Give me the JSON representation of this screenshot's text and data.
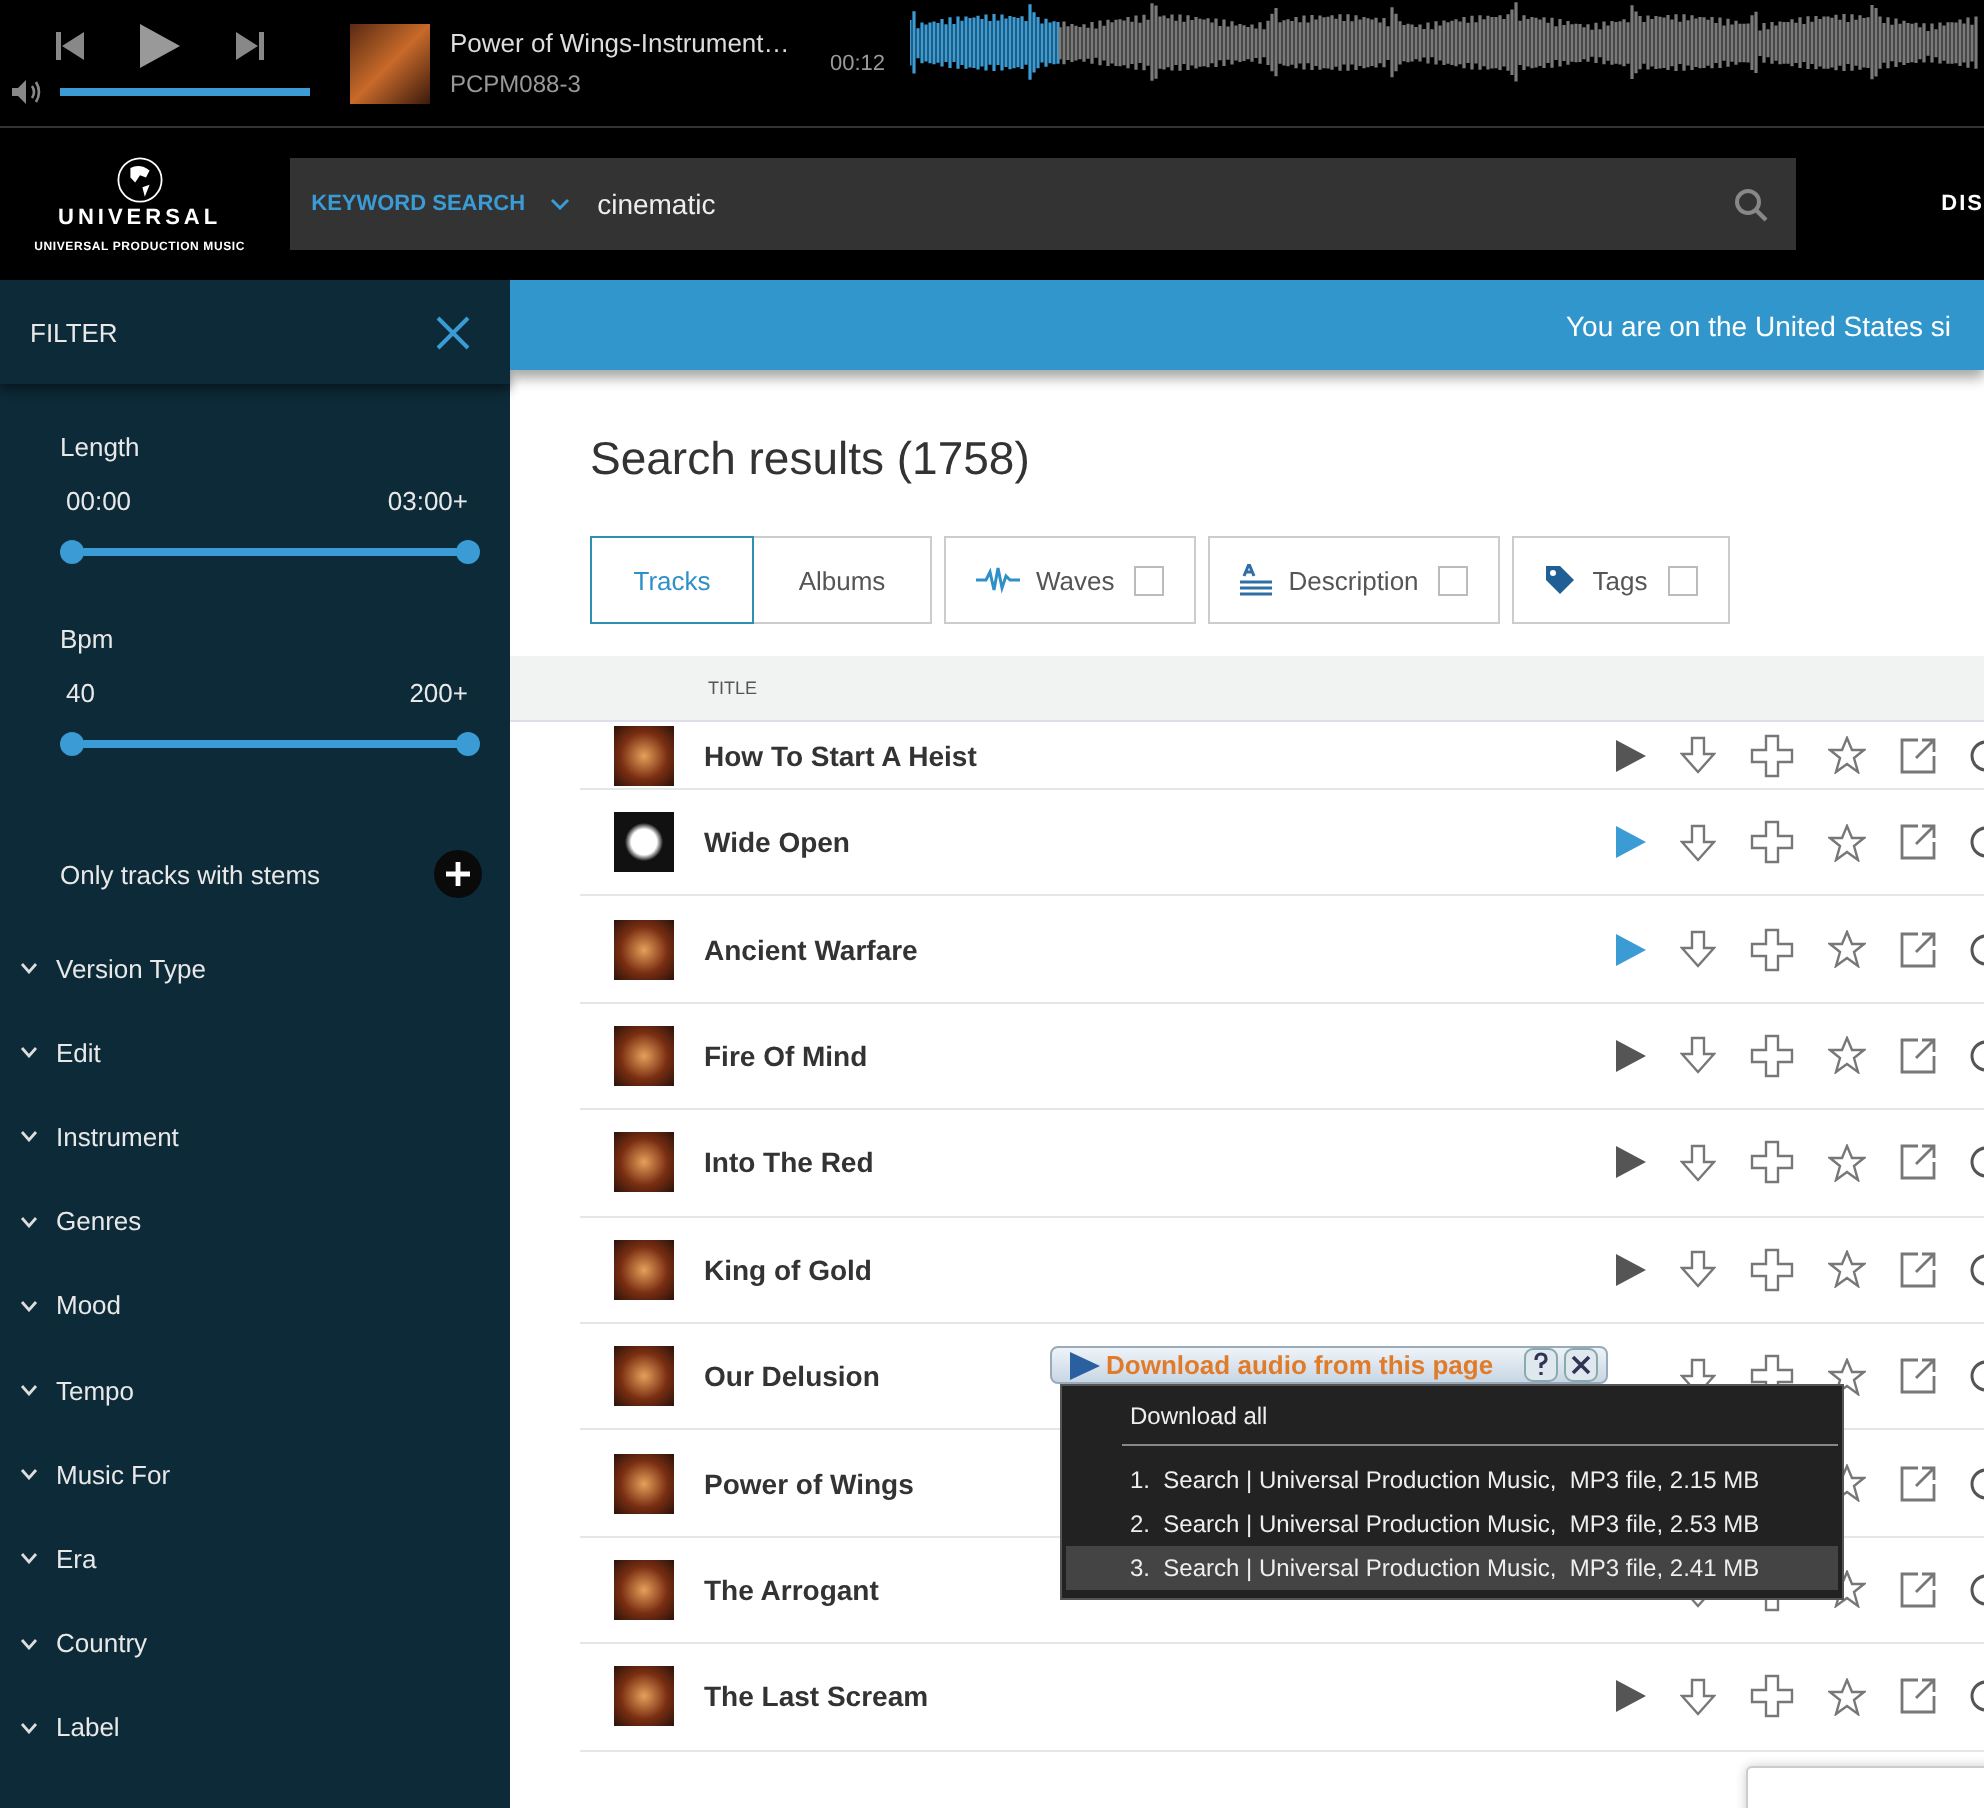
{
  "player": {
    "title": "Power of Wings-Instrument…",
    "code": "PCPM088-3",
    "time": "00:12",
    "volume": {
      "level": 1
    },
    "progress": {
      "level": 0.14
    }
  },
  "header": {
    "logo_name": "UNIVERSAL",
    "logo_tagline": "UNIVERSAL PRODUCTION MUSIC",
    "search": {
      "mode": "KEYWORD SEARCH",
      "value": "cinematic"
    },
    "nav_item": "DIS"
  },
  "banner": "You are on the United States si",
  "filter": {
    "title": "FILTER",
    "sliders": [
      {
        "label": "Length",
        "min": "00:00",
        "max": "03:00+",
        "level": 1
      },
      {
        "label": "Bpm",
        "min": "40",
        "max": "200+",
        "level": 1
      }
    ],
    "stems_label": "Only tracks with stems",
    "sections": [
      {
        "label": "Version Type",
        "expanded": false
      },
      {
        "label": "Edit",
        "expanded": false
      },
      {
        "label": "Instrument",
        "expanded": false
      },
      {
        "label": "Genres",
        "expanded": false
      },
      {
        "label": "Mood",
        "expanded": false
      },
      {
        "label": "Tempo",
        "expanded": false
      },
      {
        "label": "Music For",
        "expanded": false
      },
      {
        "label": "Era",
        "expanded": false
      },
      {
        "label": "Country",
        "expanded": false
      },
      {
        "label": "Label",
        "expanded": false
      }
    ]
  },
  "results": {
    "title": "Search results (1758)",
    "tabs": [
      {
        "label": "Tracks",
        "selected": true
      },
      {
        "label": "Albums",
        "selected": false
      }
    ],
    "toggles": [
      {
        "kind": "waves",
        "label": "Waves",
        "checked": false
      },
      {
        "kind": "description",
        "label": "Description",
        "checked": false
      },
      {
        "kind": "tags",
        "label": "Tags",
        "checked": false
      }
    ],
    "table": {
      "columns": [
        "TITLE"
      ],
      "rows": [
        {
          "title": "How To Start A Heist",
          "play_highlighted": false
        },
        {
          "title": "Wide Open",
          "play_highlighted": true
        },
        {
          "title": "Ancient Warfare",
          "play_highlighted": true
        },
        {
          "title": "Fire Of Mind",
          "play_highlighted": false
        },
        {
          "title": "Into The Red",
          "play_highlighted": false
        },
        {
          "title": "King of Gold",
          "play_highlighted": false
        },
        {
          "title": "Our Delusion"
        },
        {
          "title": "Power of Wings"
        },
        {
          "title": "The Arrogant"
        },
        {
          "title": "The Last Scream",
          "play_highlighted": false
        }
      ]
    }
  },
  "download_popup": {
    "title": "Download audio from this page",
    "menu": [
      {
        "kind": "all",
        "label": "Download all",
        "selected": false
      },
      {
        "kind": "file",
        "label": "1.  Search | Universal Production Music,  MP3 file, 2.15 MB",
        "selected": false
      },
      {
        "kind": "file",
        "label": "2.  Search | Universal Production Music,  MP3 file, 2.53 MB",
        "selected": false
      },
      {
        "kind": "file",
        "label": "3.  Search | Universal Production Music,  MP3 file, 2.41 MB",
        "selected": true
      }
    ]
  }
}
